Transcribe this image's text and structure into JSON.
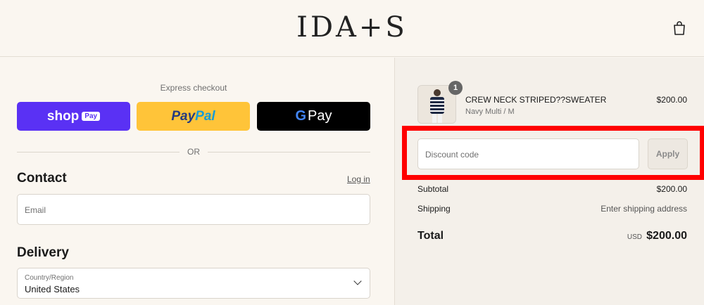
{
  "header": {
    "logo": "IDA+S",
    "bag_icon": "shopping-bag-icon"
  },
  "express": {
    "label": "Express checkout",
    "shop_pay": {
      "word": "shop",
      "chip": "Pay"
    },
    "paypal": {
      "part1": "Pay",
      "part2": "Pal"
    },
    "gpay": {
      "g": "G",
      "word": "Pay"
    },
    "or_label": "OR"
  },
  "contact": {
    "title": "Contact",
    "login_link": "Log in",
    "email_placeholder": "Email"
  },
  "delivery": {
    "title": "Delivery",
    "country_label": "Country/Region",
    "country_value": "United States"
  },
  "order": {
    "item": {
      "quantity": "1",
      "name": "CREW NECK STRIPED??SWEATER",
      "variant": "Navy Multi / M",
      "price": "$200.00"
    },
    "discount_placeholder": "Discount code",
    "apply_label": "Apply",
    "subtotal_label": "Subtotal",
    "subtotal_value": "$200.00",
    "shipping_label": "Shipping",
    "shipping_value": "Enter shipping address",
    "total_label": "Total",
    "total_currency": "USD",
    "total_value": "$200.00"
  },
  "colors": {
    "shop_pay": "#5a31f4",
    "paypal": "#ffc439",
    "highlight": "#ff0000"
  }
}
